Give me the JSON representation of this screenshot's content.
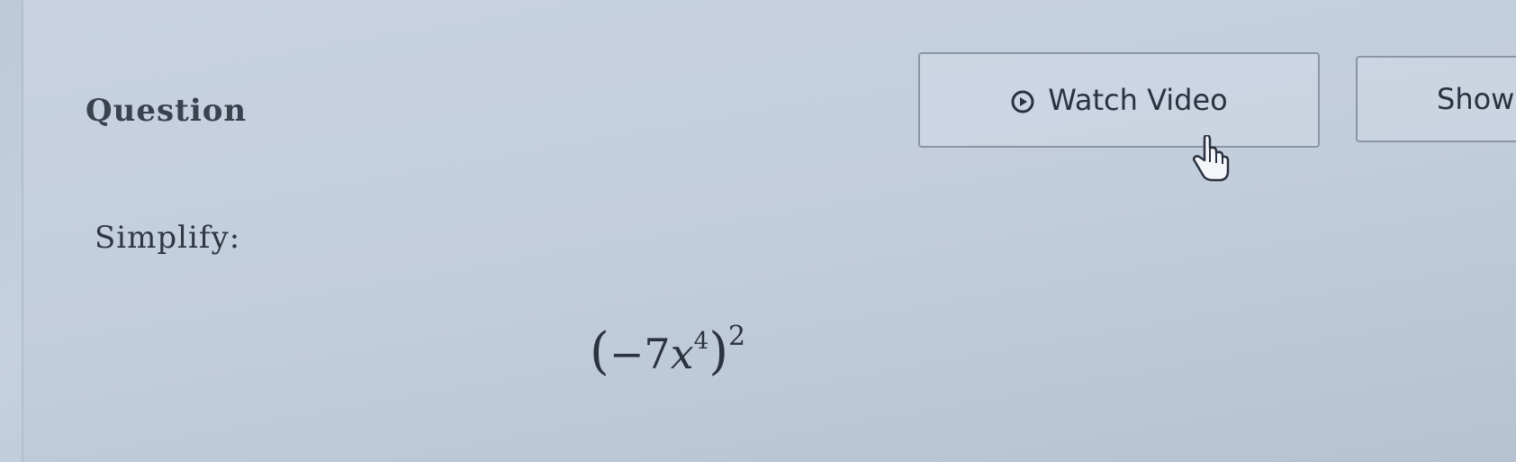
{
  "question": {
    "label": "Question"
  },
  "toolbar": {
    "watch_video_label": "Watch Video",
    "show_label": "Show"
  },
  "problem": {
    "instruction": "Simplify:",
    "expression": {
      "open_paren": "(",
      "sign": "−",
      "coefficient": "7",
      "variable": "x",
      "inner_exponent": "4",
      "close_paren": ")",
      "outer_exponent": "2"
    }
  },
  "icons": {
    "watch_video": "play-circle-icon",
    "mouse": "hand-pointer-icon"
  }
}
